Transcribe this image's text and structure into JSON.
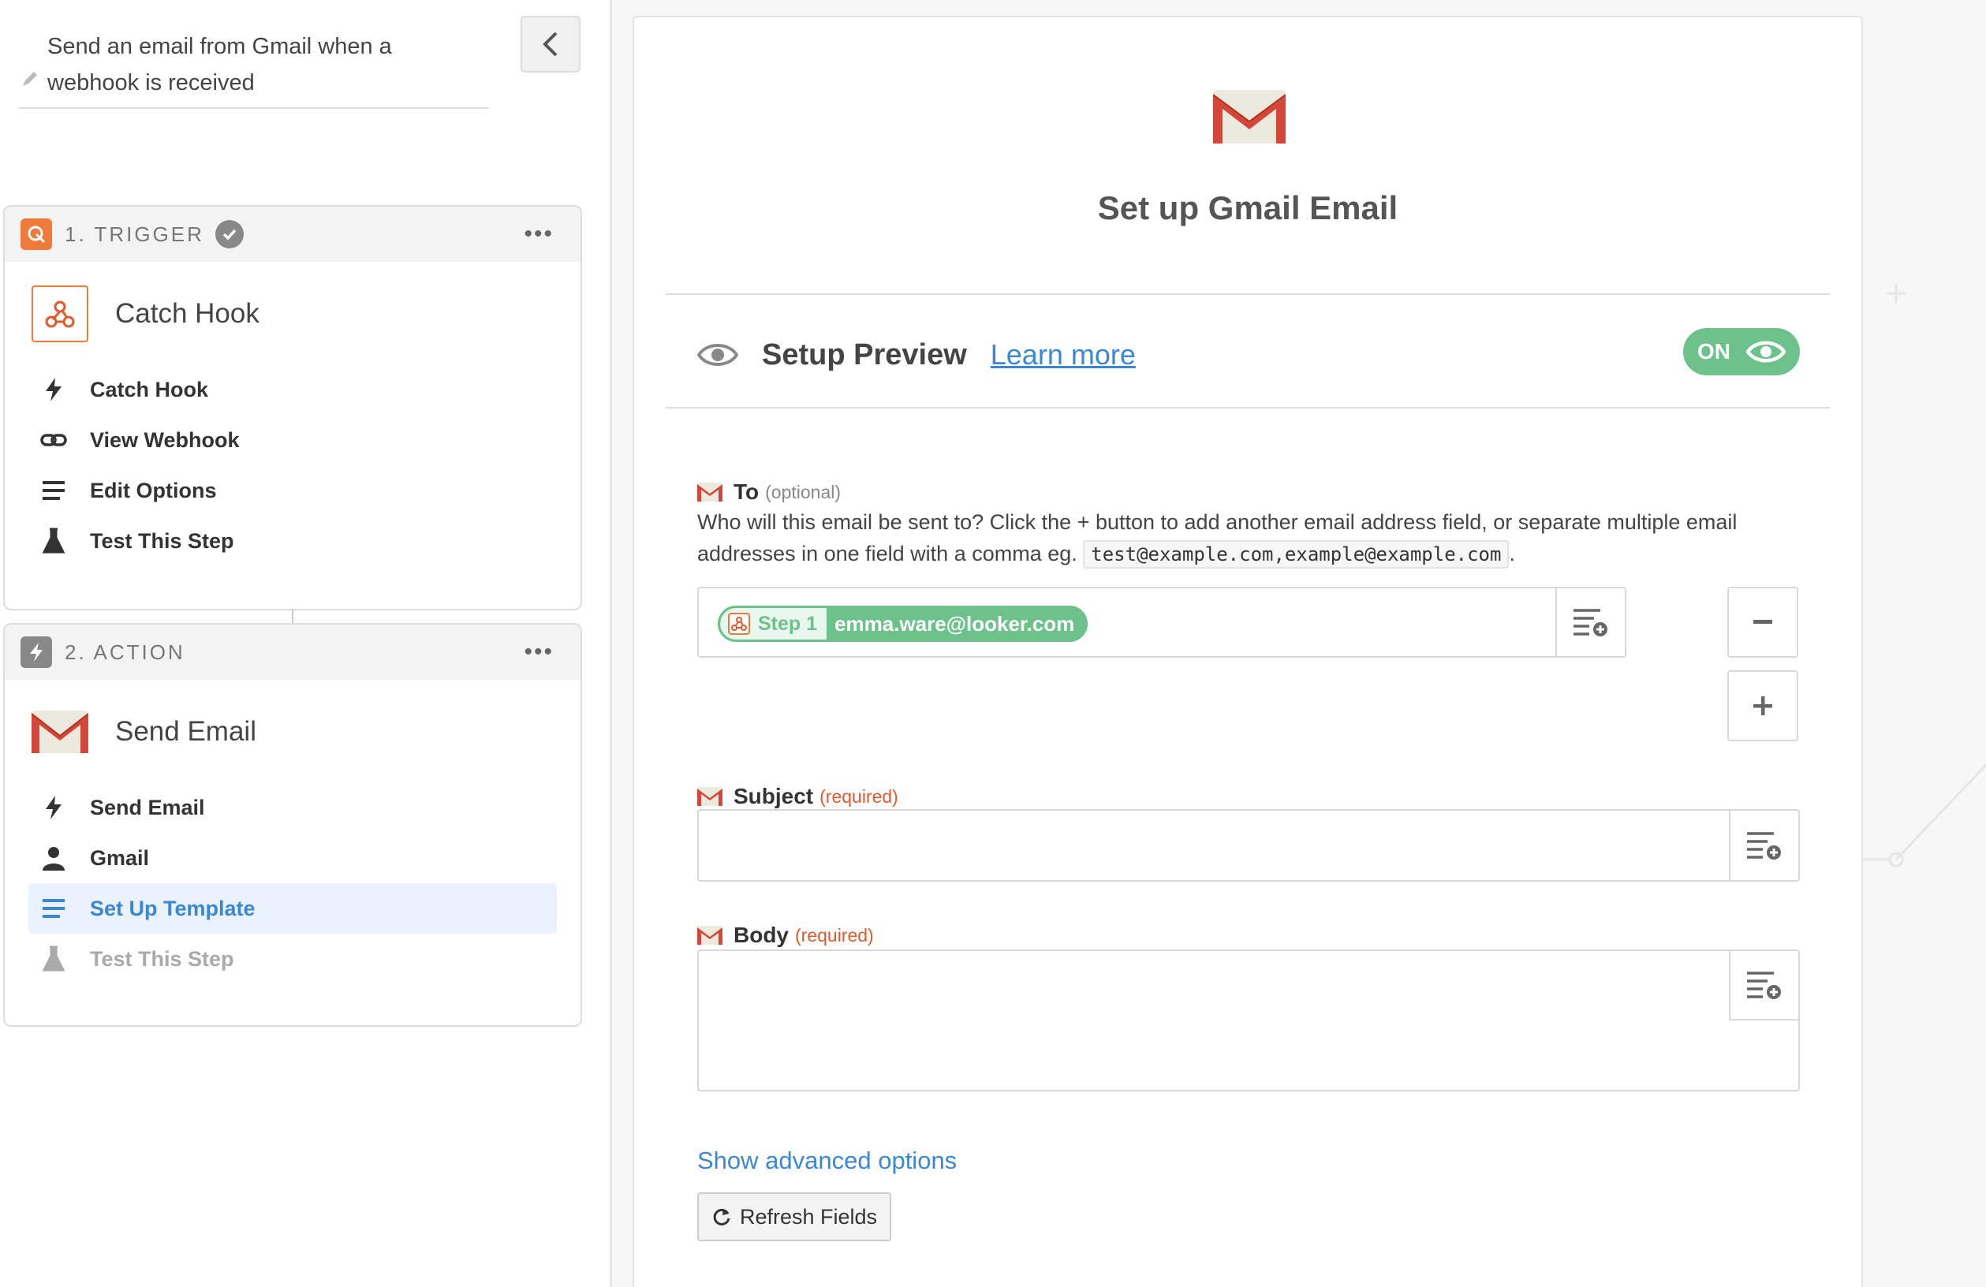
{
  "zap": {
    "title": "Send an email from Gmail when a webhook is received"
  },
  "trigger": {
    "label": "1. TRIGGER",
    "app_name": "Catch Hook",
    "menu": [
      {
        "label": "Catch Hook",
        "icon": "bolt-icon"
      },
      {
        "label": "View Webhook",
        "icon": "link-icon"
      },
      {
        "label": "Edit Options",
        "icon": "list-icon"
      },
      {
        "label": "Test This Step",
        "icon": "flask-icon"
      }
    ]
  },
  "action": {
    "label": "2. ACTION",
    "app_name": "Send Email",
    "menu": [
      {
        "label": "Send Email",
        "icon": "bolt-icon"
      },
      {
        "label": "Gmail",
        "icon": "user-icon"
      },
      {
        "label": "Set Up Template",
        "icon": "list-icon",
        "active": true
      },
      {
        "label": "Test This Step",
        "icon": "flask-icon",
        "disabled": true
      }
    ]
  },
  "panel": {
    "title": "Set up Gmail Email",
    "preview_title": "Setup Preview",
    "learn_more": "Learn more",
    "toggle_label": "ON"
  },
  "fields": {
    "to": {
      "label": "To",
      "qualifier": "(optional)",
      "help_text": "Who will this email be sent to? Click the + button to add another email address field, or separate multiple email addresses in one field with a comma eg.",
      "example": "test@example.com,example@example.com",
      "help_tail": ".",
      "pill_step": "Step 1",
      "pill_value": "emma.ware@looker.com"
    },
    "subject": {
      "label": "Subject",
      "qualifier": "(required)",
      "value": ""
    },
    "body": {
      "label": "Body",
      "qualifier": "(required)",
      "value": ""
    }
  },
  "footer": {
    "advanced_link": "Show advanced options",
    "refresh_label": "Refresh Fields"
  },
  "colors": {
    "accent_blue": "#3a88d4",
    "toggle_green": "#6cc28a",
    "required_orange": "#e05a2c",
    "webhook_orange": "#f07a3a",
    "gmail_red": "#d44638"
  }
}
